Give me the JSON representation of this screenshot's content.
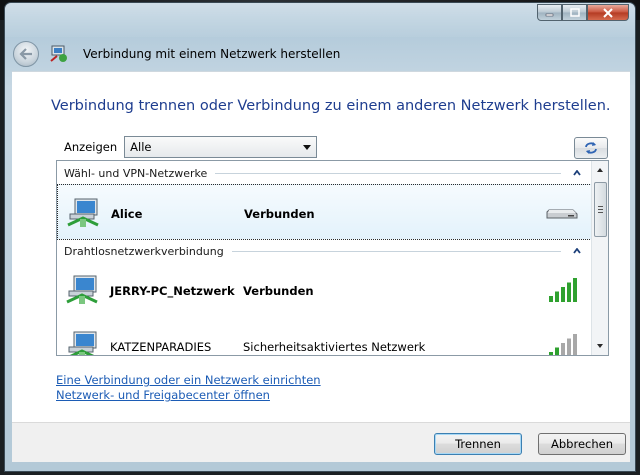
{
  "window": {
    "nav_title": "Verbindung mit einem Netzwerk herstellen"
  },
  "main": {
    "heading": "Verbindung trennen oder Verbindung zu einem anderen Netzwerk herstellen.",
    "filter_label": "Anzeigen",
    "filter_value": "Alle"
  },
  "groups": [
    {
      "title": "Wähl- und VPN-Netzwerke",
      "items": [
        {
          "name": "Alice",
          "status": "Verbunden",
          "indicator": "modem-icon",
          "selected": true
        }
      ]
    },
    {
      "title": "Drahtlosnetzwerkverbindung",
      "items": [
        {
          "name": "JERRY-PC_Netzwerk",
          "status": "Verbunden",
          "indicator": "signal-strength-icon",
          "signal_bars": 5
        },
        {
          "name": "KATZENPARADIES",
          "status": "Sicherheitsaktiviertes Netzwerk",
          "indicator": "signal-strength-icon",
          "signal_bars": 2
        }
      ]
    }
  ],
  "links": {
    "setup": "Eine Verbindung oder ein Netzwerk einrichten",
    "network_center": "Netzwerk- und Freigabecenter öffnen"
  },
  "buttons": {
    "disconnect": "Trennen",
    "cancel": "Abbrechen"
  },
  "colors": {
    "heading": "#1e3d8f",
    "link": "#1c5cb5",
    "signal_active": "#2fa12f",
    "signal_inactive": "#a8a8a8"
  }
}
